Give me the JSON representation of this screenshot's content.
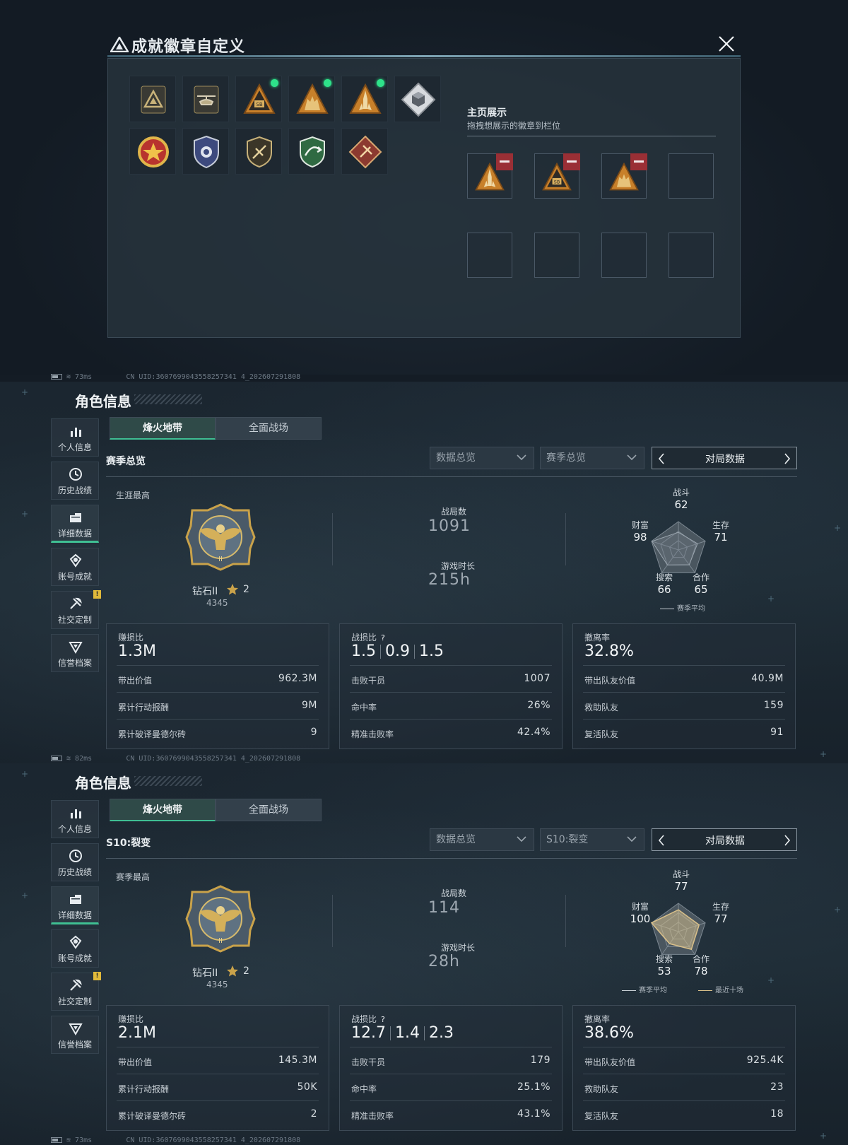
{
  "dialog": {
    "title": "成就徽章自定义",
    "showcase_title": "主页展示",
    "showcase_subtitle": "拖拽想展示的徽章到栏位",
    "badges_row1": [
      "triangle-emblem",
      "helicopter-emblem",
      "sb-triangle-badge",
      "soldiers-triangle-badge",
      "rocket-triangle-badge",
      "diamond-cube-badge"
    ],
    "badges_row2": [
      "star-medal-badge",
      "shield-blue-badge",
      "shield-gold-badge",
      "shield-green-badge",
      "diamond-red-badge"
    ],
    "badge_new_dots": [
      2,
      3,
      4
    ]
  },
  "status": [
    {
      "ping": "73ms",
      "uid": "CN UID:3607699043558257341 4_202607291808"
    },
    {
      "ping": "82ms",
      "uid": "CN UID:3607699043558257341 4_202607291808"
    },
    {
      "ping": "73ms",
      "uid": "CN UID:3607699043558257341 4_202607291808"
    }
  ],
  "nav": [
    "个人信息",
    "历史战绩",
    "详细数据",
    "账号成就",
    "社交定制",
    "信誉档案"
  ],
  "panels": [
    {
      "header": "角色信息",
      "tab_active": "烽火地带",
      "tab_inactive": "全面战场",
      "season_label": "赛季总览",
      "select1": "数据总览",
      "select2": "赛季总览",
      "pager": "对局数据",
      "best_label": "生涯最高",
      "rank": "钻石II",
      "rank_stars": "2",
      "score": "4345",
      "battles_label": "战局数",
      "battles": "1091",
      "time_label": "游戏时长",
      "time": "215h",
      "radar": {
        "labels": [
          "战斗",
          "生存",
          "合作",
          "搜索",
          "财富"
        ],
        "values": [
          "62",
          "71",
          "65",
          "66",
          "98"
        ]
      },
      "legend": [
        "赛季平均"
      ],
      "cards": [
        {
          "title": "赚损比",
          "big": [
            "1.3M"
          ],
          "rows": [
            [
              "带出价值",
              "962.3M"
            ],
            [
              "累计行动报酬",
              "9M"
            ],
            [
              "累计破译曼德尔砖",
              "9"
            ]
          ]
        },
        {
          "title": "战损比",
          "help": "?",
          "big": [
            "1.5",
            "0.9",
            "1.5"
          ],
          "rows": [
            [
              "击败干员",
              "1007"
            ],
            [
              "命中率",
              "26%"
            ],
            [
              "精准击败率",
              "42.4%"
            ]
          ]
        },
        {
          "title": "撤离率",
          "big": [
            "32.8%"
          ],
          "rows": [
            [
              "带出队友价值",
              "40.9M"
            ],
            [
              "救助队友",
              "159"
            ],
            [
              "复活队友",
              "91"
            ]
          ]
        }
      ]
    },
    {
      "header": "角色信息",
      "tab_active": "烽火地带",
      "tab_inactive": "全面战场",
      "season_label": "S10:裂变",
      "select1": "数据总览",
      "select2": "S10:裂变",
      "pager": "对局数据",
      "best_label": "赛季最高",
      "rank": "钻石II",
      "rank_stars": "2",
      "score": "4345",
      "battles_label": "战局数",
      "battles": "114",
      "time_label": "游戏时长",
      "time": "28h",
      "radar": {
        "labels": [
          "战斗",
          "生存",
          "合作",
          "搜索",
          "财富"
        ],
        "values": [
          "77",
          "77",
          "78",
          "53",
          "100"
        ]
      },
      "legend": [
        "赛季平均",
        "最近十场"
      ],
      "cards": [
        {
          "title": "赚损比",
          "big": [
            "2.1M"
          ],
          "rows": [
            [
              "带出价值",
              "145.3M"
            ],
            [
              "累计行动报酬",
              "50K"
            ],
            [
              "累计破译曼德尔砖",
              "2"
            ]
          ]
        },
        {
          "title": "战损比",
          "help": "?",
          "big": [
            "12.7",
            "1.4",
            "2.3"
          ],
          "rows": [
            [
              "击败干员",
              "179"
            ],
            [
              "命中率",
              "25.1%"
            ],
            [
              "精准击败率",
              "43.1%"
            ]
          ]
        },
        {
          "title": "撤离率",
          "big": [
            "38.6%"
          ],
          "rows": [
            [
              "带出队友价值",
              "925.4K"
            ],
            [
              "救助队友",
              "23"
            ],
            [
              "复活队友",
              "18"
            ]
          ]
        }
      ]
    }
  ],
  "colors": {
    "accent_green": "#3fbf93",
    "gold": "#c9a24a",
    "warn": "#e0b93a",
    "minus_red": "#9a2f35"
  }
}
